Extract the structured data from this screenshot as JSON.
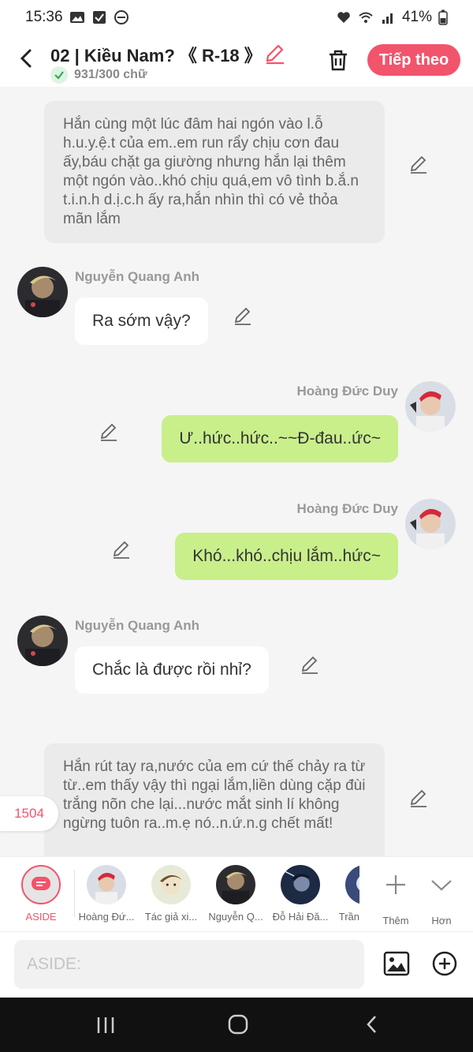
{
  "status": {
    "time": "15:36",
    "battery": "41%"
  },
  "header": {
    "title": "02 | Kiều Nam? 《 R-18 》",
    "word_count": "931/300 chữ",
    "next_label": "Tiếp theo"
  },
  "messages": [
    {
      "type": "narration",
      "text": "Hắn cùng một lúc đâm hai ngón vào l.ỗ h.u.y.ệ.t của em..em run rẩy chịu cơn đau ấy,báu chặt ga giường nhưng hắn lại thêm một ngón vào..khó chịu quá,em vô tình b.ắ.n t.i.n.h d.ị.c.h ấy ra,hắn nhìn thì có vẻ thỏa mãn lắm"
    },
    {
      "type": "left",
      "name": "Nguyễn Quang Anh",
      "text": "Ra sớm vậy?"
    },
    {
      "type": "right",
      "name": "Hoàng Đức Duy",
      "text": "Ư..hức..hức..~~Đ-đau..ức~"
    },
    {
      "type": "right",
      "name": "Hoàng Đức Duy",
      "text": "Khó...khó..chịu lắm..hức~"
    },
    {
      "type": "left",
      "name": "Nguyễn Quang Anh",
      "text": "Chắc là được rồi nhỉ?"
    },
    {
      "type": "narration",
      "text": "Hắn rút tay ra,nước của em cứ thế chảy ra từ từ..em thấy vậy thì ngại lắm,liền dùng cặp đùi trắng nõn che lại...nước mắt sinh lí không ngừng tuôn ra..m.ẹ nó..n.ứ.n.g chết mất!"
    }
  ],
  "counter": "1504",
  "characters": [
    {
      "label": "ASIDE"
    },
    {
      "label": "Hoàng Đứ..."
    },
    {
      "label": "Tác giả xi..."
    },
    {
      "label": "Nguyễn Q..."
    },
    {
      "label": "Đỗ Hải Đă..."
    },
    {
      "label": "Trần"
    },
    {
      "label": "Thêm"
    },
    {
      "label": "Hơn"
    }
  ],
  "composer": {
    "placeholder": "ASIDE:"
  },
  "colors": {
    "accent": "#f2546b",
    "right_bubble": "#c9ef8b",
    "narration_bg": "#ebebeb"
  }
}
